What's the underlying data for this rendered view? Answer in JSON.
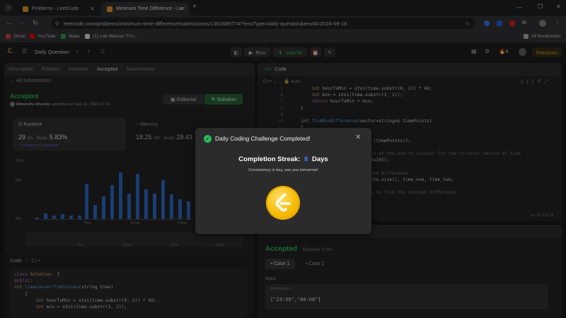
{
  "browser": {
    "tabs": [
      {
        "title": "Problems - LeetCode"
      },
      {
        "title": "Minimum Time Difference - Lee"
      }
    ],
    "new_tab": "+",
    "url": "leetcode.com/problems/minimum-time-difference/submissions/1391689774/?envType=daily-question&envId=2024-09-16",
    "bookmarks": [
      "Gmail",
      "YouTube",
      "Maps",
      "(1) Lab Manual \"Fro..."
    ],
    "all_bookmarks": "All Bookmarks"
  },
  "app": {
    "daily_question": "Daily Question",
    "run": "Run",
    "submit": "Submit",
    "streak_count": "8",
    "premium": "Premium"
  },
  "left_panel": {
    "tabs": [
      "Description",
      "Editorial",
      "Solutions",
      "Accepted",
      "Submissions"
    ],
    "all_submissions": "All Submissions",
    "status": "Accepted",
    "user": "Himanshu Kharola",
    "submitted_at": "submitted at Sep 16, 2024 10:14",
    "editorial_btn": "Editorial",
    "solution_btn": "Solution",
    "runtime_label": "Runtime",
    "runtime_value": "29",
    "runtime_unit": "ms",
    "beats_label": "Beats",
    "beats_value": "5.83%",
    "analyze": "Analyze Complexity",
    "memory_label": "Memory",
    "memory_value": "18.25",
    "memory_unit": "MB",
    "memory_beats_prefix": "Beats",
    "memory_beats": "28.43",
    "chart": {
      "y_ticks": [
        "10%",
        "5%",
        "0%"
      ],
      "x_ticks": [
        "7ms",
        "12ms",
        "17ms",
        "22ms"
      ],
      "mini_ticks": [
        "2ms",
        "7ms",
        "12ms",
        "17ms",
        "22ms"
      ]
    },
    "code_header": "Code",
    "code_lang": "C++",
    "code_lines": [
      [
        [
          "kw",
          "class "
        ],
        [
          "ty",
          "Solution"
        ],
        [
          "",
          "  {"
        ]
      ],
      [
        [
          "kw",
          "public"
        ],
        [
          "",
          ":"
        ]
      ],
      [
        [
          "",
          ""
        ],
        [
          "ty",
          "int "
        ],
        [
          "fn",
          "timeConvertToMinutes"
        ],
        [
          "",
          "(string time)"
        ]
      ],
      [
        [
          "",
          "    {"
        ]
      ],
      [
        [
          "",
          "        "
        ],
        [
          "ty",
          "int "
        ],
        [
          "",
          "hourToMin = stoi(time.substr(0, 2)) * 60;"
        ]
      ],
      [
        [
          "",
          "        "
        ],
        [
          "ty",
          "int "
        ],
        [
          "",
          "min = stoi(time.substr(3, 2));"
        ]
      ]
    ]
  },
  "editor": {
    "title": "Code",
    "lang": "C++",
    "auto": "Auto",
    "line_numbers": [
      "5",
      "6",
      "7",
      "8",
      "9",
      "10",
      "11",
      "12",
      "13",
      "14",
      "15",
      "16",
      "17",
      "18",
      "19",
      "20",
      "21"
    ],
    "lines": [
      [
        [
          "",
          "        "
        ],
        [
          "ty",
          "int "
        ],
        [
          "",
          "hourToMin = stoi(time.substr(0, 2)) * 60;"
        ]
      ],
      [
        [
          "",
          "        "
        ],
        [
          "ty",
          "int "
        ],
        [
          "",
          "min = stoi(time.substr(3, 2));"
        ]
      ],
      [
        [
          "",
          "        "
        ],
        [
          "kw",
          "return "
        ],
        [
          "",
          "hourToMin + min;"
        ]
      ],
      [
        [
          "",
          "    }"
        ]
      ],
      [
        [
          "",
          ""
        ]
      ],
      [
        [
          "",
          "    "
        ],
        [
          "ty",
          "int "
        ],
        [
          "fn",
          "findMinDifference"
        ],
        [
          "",
          "(vector<string>& timePoints)"
        ]
      ],
      [
        [
          "",
          "    {"
        ]
      ],
      [
        [
          "",
          "        "
        ],
        [
          "",
          ""
        ]
      ],
      [
        [
          "",
          "                               (timePoints));"
        ]
      ],
      [
        [
          "",
          ""
        ]
      ],
      [
        [
          "cm",
          "                           again at the end to account for the circular nature of time"
        ]
      ],
      [
        [
          "",
          "                           oints[0]);"
        ]
      ],
      [
        [
          "",
          ""
        ]
      ],
      [
        [
          "cm",
          "                           inimum difference"
        ]
      ],
      [
        [
          "",
          "                           Points.size(), time_one, time_two;"
        ]
      ],
      [
        [
          "",
          ""
        ]
      ],
      [
        [
          "cm",
          "                           ints to find the minimum difference"
        ]
      ],
      [
        [
          "",
          "                           ++)"
        ]
      ]
    ],
    "status": "Ln 13, Col 15"
  },
  "testresult": {
    "status": "Accepted",
    "runtime": "Runtime: 0 ms",
    "case1": "Case 1",
    "case2": "Case 2",
    "input_label": "Input",
    "var_name": "timePoints =",
    "var_value": "[\"23:59\",\"00:00\"]"
  },
  "modal": {
    "title": "Daily Coding Challenge Completed!",
    "streak_label": "Completion Streak:",
    "streak_value": "8",
    "streak_unit": "Days",
    "message": "Consistency is key, see you tomorrow!"
  }
}
